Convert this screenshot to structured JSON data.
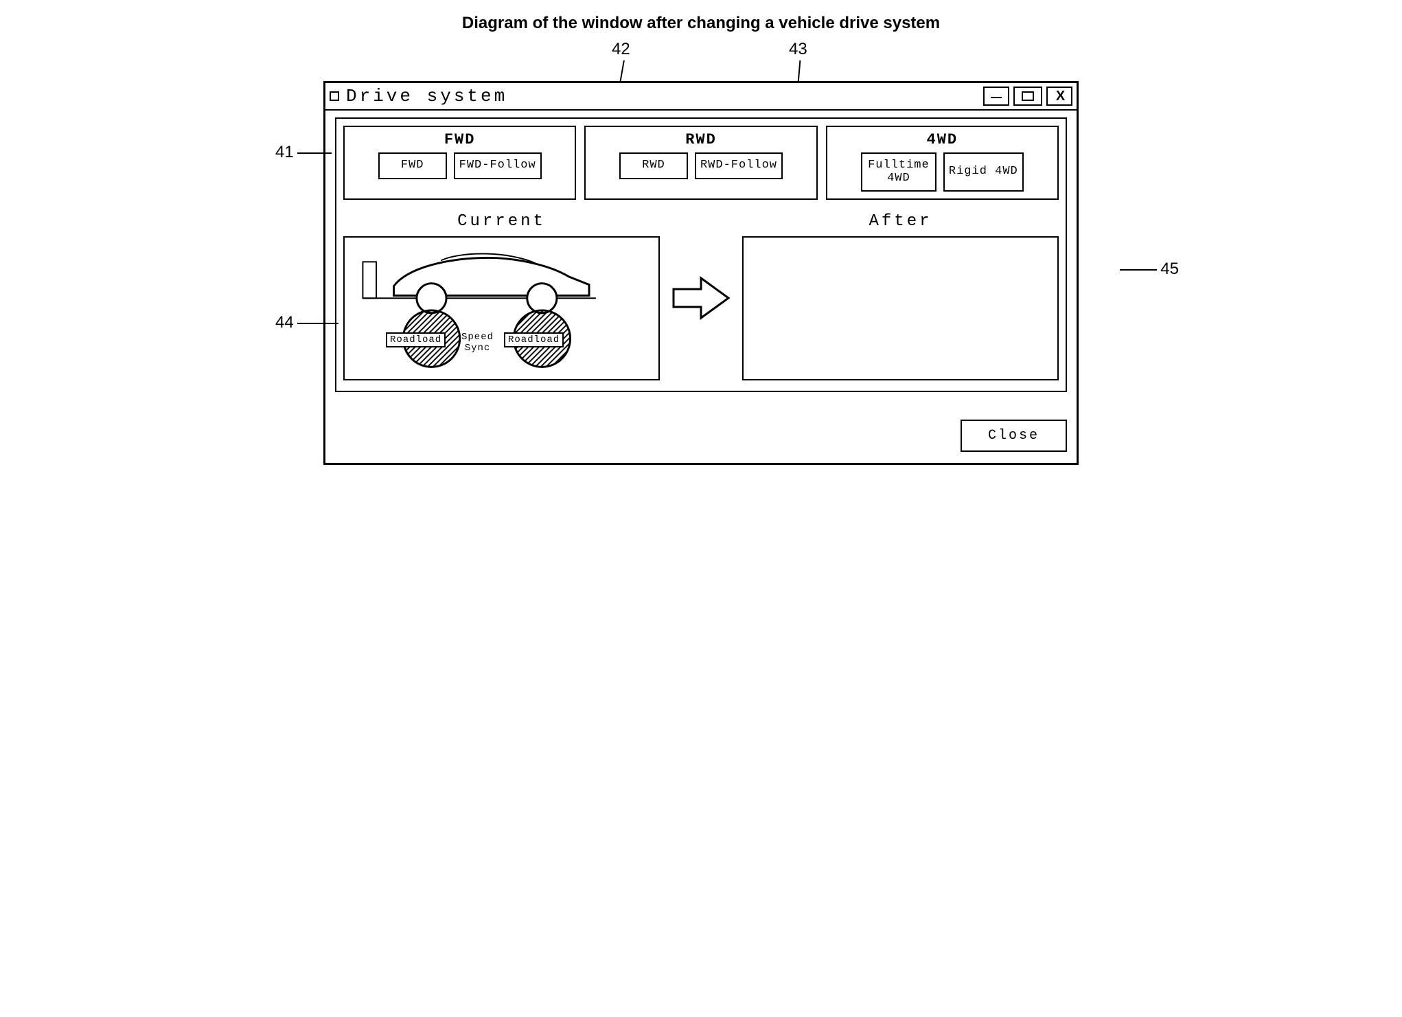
{
  "caption": "Diagram of the window after changing a vehicle drive system",
  "callouts": {
    "c41": "41",
    "c42": "42",
    "c43": "43",
    "c44": "44",
    "c45": "45"
  },
  "window": {
    "title": "Drive system"
  },
  "drive_groups": [
    {
      "title": "FWD",
      "options": [
        "FWD",
        "FWD-Follow"
      ]
    },
    {
      "title": "RWD",
      "options": [
        "RWD",
        "RWD-Follow"
      ]
    },
    {
      "title": "4WD",
      "options": [
        "Fulltime\n4WD",
        "Rigid 4WD"
      ]
    }
  ],
  "preview": {
    "current_label": "Current",
    "after_label": "After",
    "roller_front": "Roadload",
    "speed_sync": "Speed\nSync",
    "roller_rear": "Roadload"
  },
  "buttons": {
    "close": "Close"
  }
}
